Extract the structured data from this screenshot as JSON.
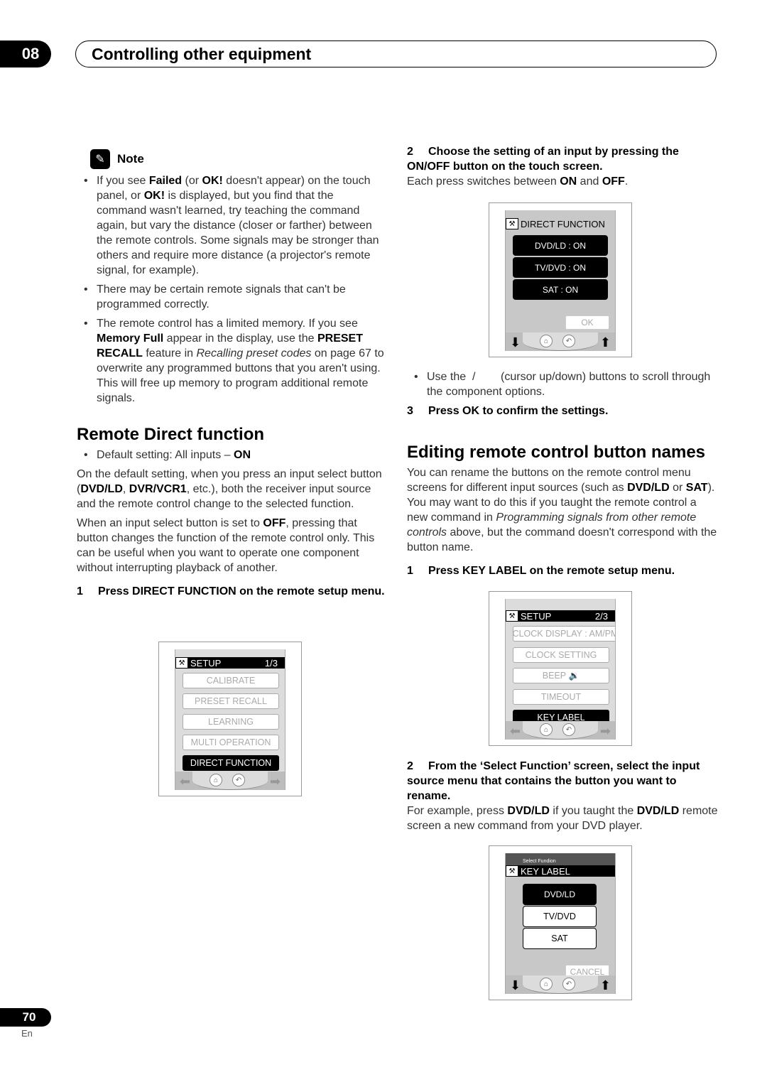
{
  "header": {
    "chapter_number": "08",
    "chapter_title": "Controlling other equipment"
  },
  "note": {
    "icon": "pencil-icon",
    "label": "Note",
    "bullets": [
      {
        "parts": [
          {
            "t": "If you see "
          },
          {
            "b": "Failed"
          },
          {
            "t": " (or "
          },
          {
            "b": "OK!"
          },
          {
            "t": " doesn't appear) on the touch panel, or "
          },
          {
            "b": "OK!"
          },
          {
            "t": " is displayed, but you find that the command wasn't learned, try teaching the command again, but vary the distance (closer or farther) between the remote controls. Some signals may be stronger than others and require more distance (a projector's remote signal, for example)."
          }
        ]
      },
      {
        "parts": [
          {
            "t": "There may be certain remote signals that can't be programmed correctly."
          }
        ]
      },
      {
        "parts": [
          {
            "t": "The remote control has a limited memory. If you see "
          },
          {
            "b": "Memory Full"
          },
          {
            "t": " appear in the display, use the "
          },
          {
            "b": "PRESET RECALL"
          },
          {
            "t": " feature in "
          },
          {
            "i": "Recalling preset codes"
          },
          {
            "t": " on page 67 to overwrite any programmed buttons that you aren't using. This will free up memory to program additional remote signals."
          }
        ]
      }
    ]
  },
  "remote_direct": {
    "heading": "Remote Direct function",
    "default_bullet": [
      {
        "t": "Default setting: All inputs – "
      },
      {
        "b": "ON"
      }
    ],
    "para1": [
      {
        "t": "On the default setting, when you press an input select button ("
      },
      {
        "b": "DVD/LD"
      },
      {
        "t": ", "
      },
      {
        "b": "DVR/VCR1"
      },
      {
        "t": ", etc.), both the receiver input source and the remote control change to the selected function."
      }
    ],
    "para2": [
      {
        "t": "When an input select button is set to "
      },
      {
        "b": "OFF"
      },
      {
        "t": ", pressing that button changes the function of the remote control only. This can be useful when you want to operate one component without interrupting playback of another."
      }
    ],
    "step1": {
      "num": "1",
      "text": "Press DIRECT FUNCTION on the remote setup menu."
    },
    "screen1": {
      "title": "SETUP",
      "page": "1/3",
      "items": [
        {
          "label": "CALIBRATE",
          "active": false
        },
        {
          "label": "PRESET  RECALL",
          "active": false
        },
        {
          "label": "LEARNING",
          "active": false
        },
        {
          "label": "MULTI  OPERATION",
          "active": false
        },
        {
          "label": "DIRECT  FUNCTION",
          "active": true
        }
      ]
    },
    "step2": {
      "num": "2",
      "text": "Choose the setting of an input by pressing the ON/OFF button on the touch screen."
    },
    "step2_desc": [
      {
        "t": "Each press switches between "
      },
      {
        "b": "ON"
      },
      {
        "t": " and "
      },
      {
        "b": "OFF"
      },
      {
        "t": "."
      }
    ],
    "screen2": {
      "title": "DIRECT  FUNCTION",
      "items": [
        "DVD/LD : ON",
        "TV/DVD : ON",
        "SAT : ON"
      ],
      "ok_label": "OK"
    },
    "cursor_bullet": "Use the  /        (cursor up/down) buttons to scroll through the component options.",
    "step3": {
      "num": "3",
      "text": "Press OK to confirm the settings."
    }
  },
  "editing": {
    "heading": "Editing remote control button names",
    "para": [
      {
        "t": "You can rename the buttons on the remote control menu screens for different input sources (such as "
      },
      {
        "b": "DVD/LD"
      },
      {
        "t": " or "
      },
      {
        "b": "SAT"
      },
      {
        "t": "). You may want to do this if you taught the remote control a new command in "
      },
      {
        "i": "Programming signals from other remote controls"
      },
      {
        "t": " above, but the command doesn't correspond with the button name."
      }
    ],
    "step1": {
      "num": "1",
      "text": "Press KEY LABEL on the remote setup menu."
    },
    "screen3": {
      "title": "SETUP",
      "page": "2/3",
      "items": [
        {
          "label": "CLOCK  DISPLAY : AM/PM",
          "active": false
        },
        {
          "label": "CLOCK  SETTING",
          "active": false
        },
        {
          "label": "BEEP",
          "active": false,
          "icon": "speaker-icon"
        },
        {
          "label": "TIMEOUT",
          "active": false
        },
        {
          "label": "KEY  LABEL",
          "active": true
        }
      ]
    },
    "step2": {
      "num": "2",
      "text": "From the ‘Select Function’ screen, select the input source menu that contains the button you want to rename."
    },
    "step2_desc": [
      {
        "t": "For example, press "
      },
      {
        "b": "DVD/LD"
      },
      {
        "t": " if you taught the "
      },
      {
        "b": "DVD/LD"
      },
      {
        "t": " remote screen a new command from your DVD player."
      }
    ],
    "screen4": {
      "subtitle": "Select Fundion",
      "title": "KEY  LABEL",
      "items": [
        {
          "label": "DVD/LD",
          "active": true
        },
        {
          "label": "TV/DVD",
          "active": false
        },
        {
          "label": "SAT",
          "active": false
        }
      ],
      "cancel_label": "CANCEL"
    }
  },
  "footer": {
    "page_number": "70",
    "language": "En"
  }
}
